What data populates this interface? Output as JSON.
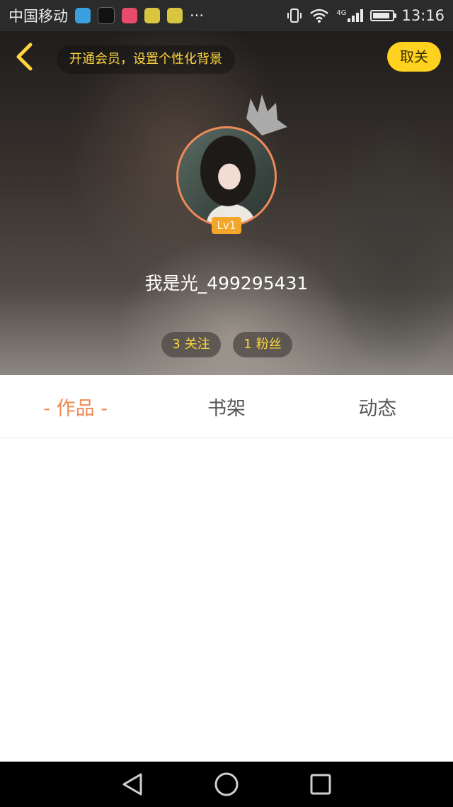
{
  "status_bar": {
    "carrier": "中国移动",
    "more": "···",
    "network": "4G",
    "time": "13:16",
    "battery_level": 0.85,
    "app_icon_colors": [
      "#3aa0e0",
      "#111111",
      "#e94b6a",
      "#d8c640",
      "#d8c640"
    ]
  },
  "header": {
    "vip_banner": "开通会员，设置个性化背景",
    "cancel_label": "取关",
    "level": "Lv1",
    "username": "我是光_499295431",
    "stats": [
      {
        "count": "3",
        "label": "关注"
      },
      {
        "count": "1",
        "label": "粉丝"
      }
    ]
  },
  "tabs": [
    {
      "label": "- 作品 -",
      "active": true
    },
    {
      "label": "书架",
      "active": false
    },
    {
      "label": "动态",
      "active": false
    }
  ],
  "colors": {
    "accent_yellow": "#ffd21f",
    "tab_active": "#f08a52",
    "avatar_ring": "#ee8a5a",
    "level_badge": "#f2a72a"
  }
}
